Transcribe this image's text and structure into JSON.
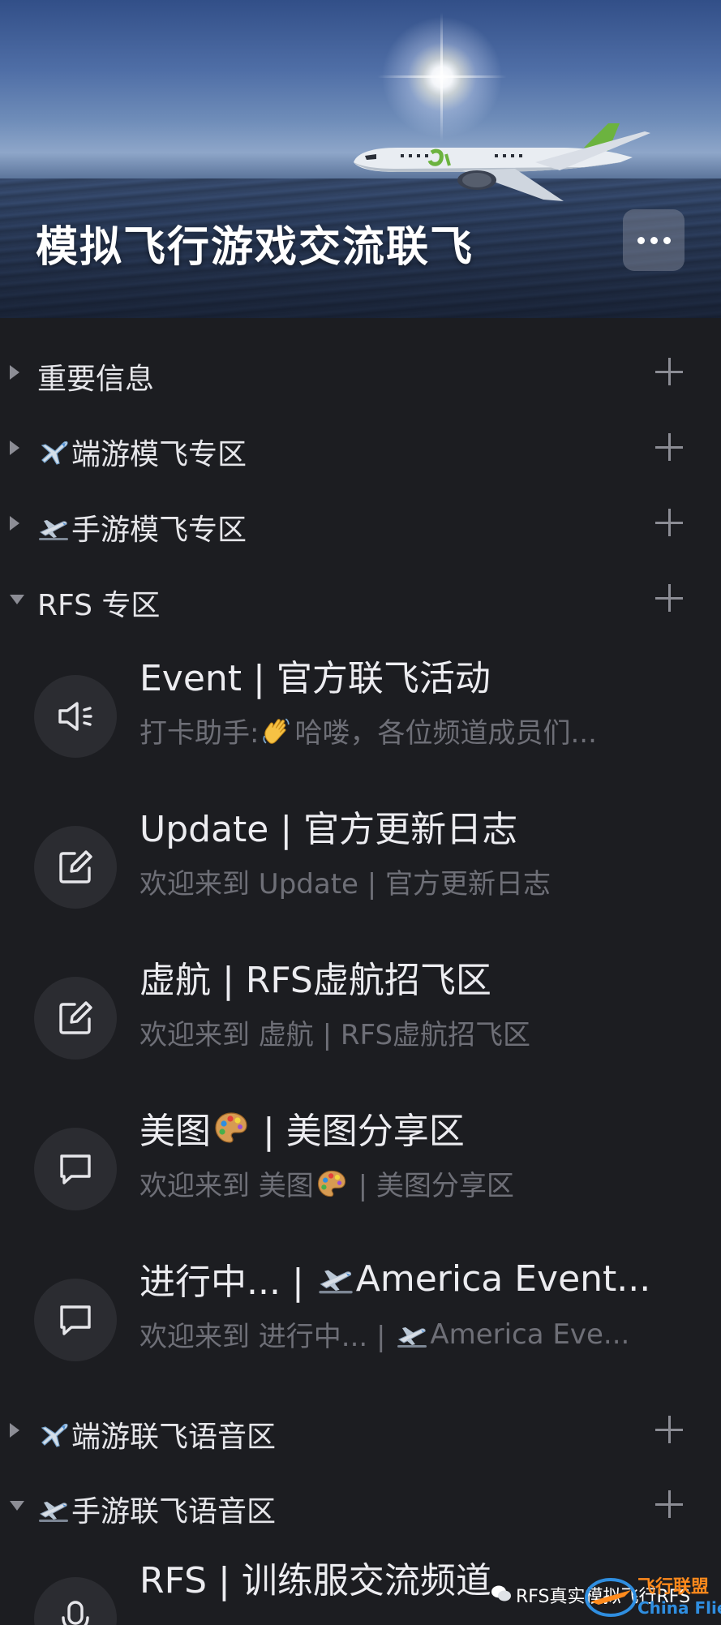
{
  "header": {
    "title": "模拟飞行游戏交流联飞",
    "more_icon": "more-horizontal-icon"
  },
  "categories": [
    {
      "label": "重要信息",
      "emoji": "",
      "expanded": false
    },
    {
      "label": "端游模飞专区",
      "emoji": "airplane-emoji",
      "expanded": false
    },
    {
      "label": "手游模飞专区",
      "emoji": "airplane-departure-emoji",
      "expanded": false
    },
    {
      "label": "RFS 专区",
      "emoji": "",
      "expanded": true
    },
    {
      "label": "端游联飞语音区",
      "emoji": "airplane-emoji",
      "expanded": false
    },
    {
      "label": "手游联飞语音区",
      "emoji": "airplane-departure-emoji",
      "expanded": true
    }
  ],
  "channels": [
    {
      "icon": "speaker-icon",
      "name": "Event | 官方联飞活动",
      "sub_prefix": "打卡助手: ",
      "sub_emoji": "waving-hand-emoji",
      "sub_suffix": "哈喽，各位频道成员们..."
    },
    {
      "icon": "edit-icon",
      "name": "Update | 官方更新日志",
      "sub": "欢迎来到 Update | 官方更新日志"
    },
    {
      "icon": "edit-icon",
      "name": "虚航 | RFS虚航招飞区",
      "sub": "欢迎来到 虚航 | RFS虚航招飞区"
    },
    {
      "icon": "chat-bubble-icon",
      "name_prefix": "美图",
      "name_emoji": "palette-emoji",
      "name_suffix": " | 美图分享区",
      "sub_prefix": "欢迎来到 美图",
      "sub_emoji": "palette-emoji",
      "sub_suffix": " | 美图分享区"
    },
    {
      "icon": "chat-bubble-icon",
      "name_prefix": "进行中... | ",
      "name_emoji": "airplane-departure-emoji",
      "name_suffix": "America Event...",
      "sub_prefix": "欢迎来到 进行中... | ",
      "sub_emoji": "airplane-departure-emoji",
      "sub_suffix": "America Eve..."
    },
    {
      "icon": "microphone-icon",
      "name": "RFS | 训练服交流频道"
    }
  ],
  "watermark": {
    "text": "RFS真实模拟飞行RFS",
    "brand_cn": "飞行联盟",
    "brand_en": "China Flier"
  },
  "colors": {
    "background": "#1c1d21",
    "icon_circle": "#2b2c31",
    "secondary_text": "#6e6f77",
    "arrow_plus": "#8c8d95",
    "brand_blue": "#2f8ee0",
    "brand_orange": "#ff8a1c"
  }
}
